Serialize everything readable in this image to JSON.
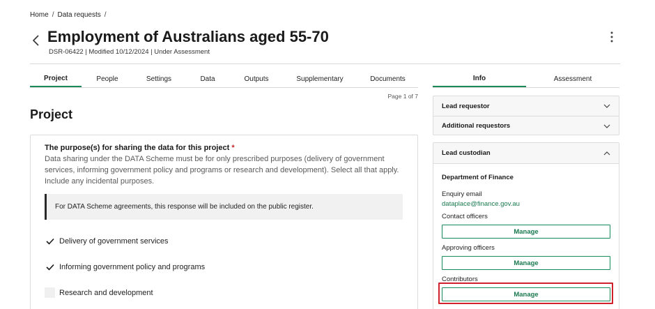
{
  "breadcrumb": {
    "home": "Home",
    "data_requests": "Data requests",
    "sep": "/"
  },
  "header": {
    "title": "Employment of Australians aged 55-70",
    "meta": "DSR-06422 | Modified 10/12/2024 | Under Assessment"
  },
  "tabs": [
    {
      "label": "Project"
    },
    {
      "label": "People"
    },
    {
      "label": "Settings"
    },
    {
      "label": "Data"
    },
    {
      "label": "Outputs"
    },
    {
      "label": "Supplementary"
    },
    {
      "label": "Documents"
    }
  ],
  "page_count": "Page 1 of 7",
  "section_title": "Project",
  "question": {
    "title": "The purpose(s) for sharing the data for this project",
    "required_mark": "*",
    "description": "Data sharing under the DATA Scheme must be for only prescribed purposes (delivery of government services, informing government policy and programs or research and development). Select all that apply. Include any incidental purposes.",
    "notice": "For DATA Scheme agreements, this response will be included on the public register.",
    "options": [
      {
        "label": "Delivery of government services",
        "checked": true
      },
      {
        "label": "Informing government policy and programs",
        "checked": true
      },
      {
        "label": "Research and development",
        "checked": false
      }
    ]
  },
  "side_tabs": [
    {
      "label": "Info"
    },
    {
      "label": "Assessment"
    }
  ],
  "accordion": {
    "lead_requestor": "Lead requestor",
    "additional_requestors": "Additional requestors"
  },
  "custodian": {
    "heading": "Lead custodian",
    "organisation": "Department of Finance",
    "enquiry_label": "Enquiry email",
    "enquiry_email": "dataplace@finance.gov.au",
    "contact_label": "Contact officers",
    "approving_label": "Approving officers",
    "contributors_label": "Contributors",
    "manage_label": "Manage"
  },
  "colors": {
    "accent": "#1a8a5a",
    "highlight": "#d0202b",
    "required": "#c62828"
  }
}
